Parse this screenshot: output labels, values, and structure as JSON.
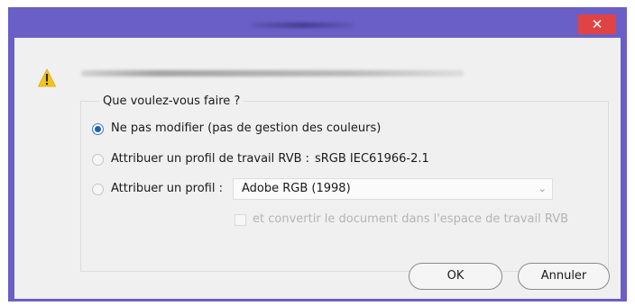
{
  "titlebar": {
    "close_glyph": "✕"
  },
  "dialog": {
    "icon": "warning-icon",
    "group_label": "Que voulez-vous faire ?",
    "options": [
      {
        "label": "Ne pas modifier (pas de gestion des couleurs)",
        "selected": true
      },
      {
        "label": "Attribuer un profil de travail RVB :",
        "value": "sRGB IEC61966-2.1",
        "selected": false
      },
      {
        "label": "Attribuer un profil :",
        "selected": false
      }
    ],
    "profile_select": {
      "value": "Adobe RGB (1998)"
    },
    "convert_checkbox": {
      "label": "et convertir le document dans l'espace de travail RVB",
      "checked": false,
      "disabled": true
    },
    "buttons": {
      "ok": "OK",
      "cancel": "Annuler"
    }
  },
  "colors": {
    "frame": "#6a5fc7",
    "close": "#e04343",
    "accent": "#1f5fae",
    "warning": "#f5c518"
  }
}
